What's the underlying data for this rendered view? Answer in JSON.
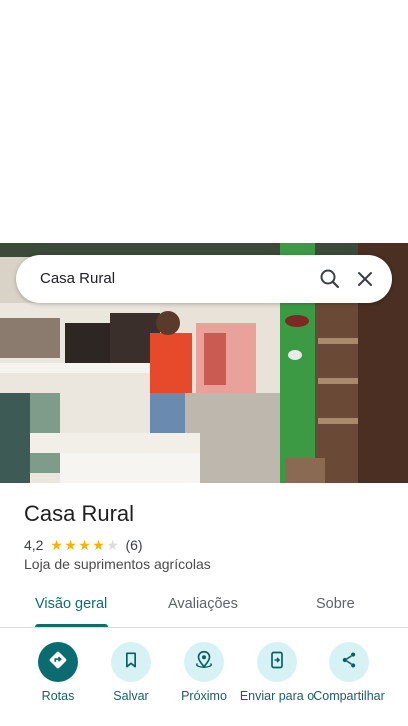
{
  "search": {
    "query": "Casa Rural"
  },
  "place": {
    "name": "Casa Rural",
    "rating": "4,2",
    "rating_value": 4.2,
    "review_count": "(6)",
    "category": "Loja de suprimentos agrícolas"
  },
  "tabs": [
    {
      "label": "Visão geral",
      "active": true
    },
    {
      "label": "Avaliações",
      "active": false
    },
    {
      "label": "Sobre",
      "active": false
    }
  ],
  "actions": [
    {
      "label": "Rotas",
      "icon": "directions-icon"
    },
    {
      "label": "Salvar",
      "icon": "bookmark-icon"
    },
    {
      "label": "Próximo",
      "icon": "nearby-icon"
    },
    {
      "label": "Enviar para o",
      "icon": "send-to-phone-icon"
    },
    {
      "label": "Compartilhar",
      "icon": "share-icon"
    }
  ],
  "colors": {
    "accent": "#0b6f6b",
    "action_bg": "#d7f2f4",
    "star": "#f4b400",
    "star_empty": "#dadce0"
  }
}
